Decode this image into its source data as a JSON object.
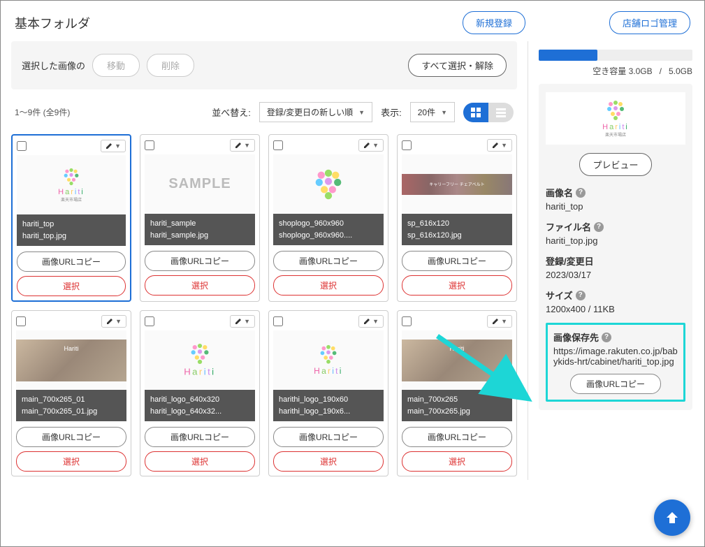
{
  "page": {
    "title": "基本フォルダ",
    "new_register": "新規登録",
    "shop_logo_manage": "店舗ロゴ管理"
  },
  "toolbar": {
    "selected_images": "選択した画像の",
    "move": "移動",
    "delete": "削除",
    "select_all": "すべて選択・解除"
  },
  "list": {
    "count": "1〜9件 (全9件)",
    "sort_label": "並べ替え:",
    "sort_value": "登録/変更日の新しい順",
    "display_label": "表示:",
    "display_value": "20件"
  },
  "cards": [
    {
      "name": "hariti_top",
      "file": "hariti_top.jpg",
      "thumb": "logo",
      "selected": true
    },
    {
      "name": "hariti_sample",
      "file": "hariti_sample.jpg",
      "thumb": "sample",
      "selected": false
    },
    {
      "name": "shoplogo_960x960",
      "file": "shoplogo_960x960....",
      "thumb": "heart",
      "selected": false
    },
    {
      "name": "sp_616x120",
      "file": "sp_616x120.jpg",
      "thumb": "banner",
      "selected": false
    },
    {
      "name": "main_700x265_01",
      "file": "main_700x265_01.jpg",
      "thumb": "photo",
      "selected": false
    },
    {
      "name": "hariti_logo_640x320",
      "file": "hariti_logo_640x32...",
      "thumb": "logo2",
      "selected": false
    },
    {
      "name": "harithi_logo_190x60",
      "file": "harithi_logo_190x6...",
      "thumb": "logo3",
      "selected": false
    },
    {
      "name": "main_700x265",
      "file": "main_700x265.jpg",
      "thumb": "photo",
      "selected": false
    }
  ],
  "actions": {
    "copy_url": "画像URLコピー",
    "select": "選択"
  },
  "capacity": {
    "label": "空き容量",
    "free": "3.0GB",
    "sep": "/",
    "total": "5.0GB"
  },
  "detail": {
    "preview_btn": "プレビュー",
    "image_name_label": "画像名",
    "image_name": "hariti_top",
    "file_name_label": "ファイル名",
    "file_name": "hariti_top.jpg",
    "date_label": "登録/変更日",
    "date": "2023/03/17",
    "size_label": "サイズ",
    "size": "1200x400 / 11KB",
    "url_label": "画像保存先",
    "url": "https://image.rakuten.co.jp/babykids-hrt/cabinet/hariti_top.jpg",
    "copy_url": "画像URLコピー"
  }
}
